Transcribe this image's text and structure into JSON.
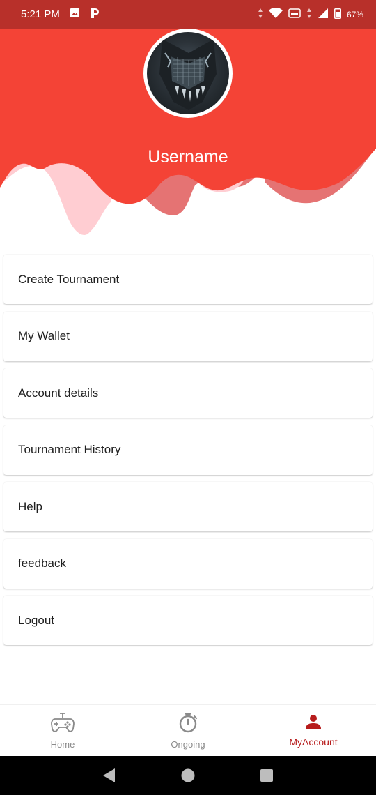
{
  "status_bar": {
    "time": "5:21 PM",
    "battery": "67%",
    "icons": [
      "image-icon",
      "p-app-icon",
      "data-arrows-icon",
      "wifi-icon",
      "volte-icon",
      "signal-icon",
      "battery-icon"
    ]
  },
  "profile": {
    "username": "Username",
    "avatar": "masked-face-avatar"
  },
  "menu": {
    "items": [
      {
        "label": "Create Tournament"
      },
      {
        "label": "My Wallet"
      },
      {
        "label": "Account details"
      },
      {
        "label": "Tournament History"
      },
      {
        "label": "Help"
      },
      {
        "label": "feedback"
      },
      {
        "label": "Logout"
      }
    ]
  },
  "bottom_nav": {
    "tabs": [
      {
        "label": "Home",
        "icon": "gamepad-icon"
      },
      {
        "label": "Ongoing",
        "icon": "stopwatch-icon"
      },
      {
        "label": "MyAccount",
        "icon": "person-icon",
        "active": true
      }
    ]
  },
  "system_nav": {
    "buttons": [
      "back-icon",
      "home-circle-icon",
      "recents-square-icon"
    ]
  },
  "colors": {
    "status_bar": "#b8302a",
    "header_red": "#f44336",
    "wave_mid": "#e57373",
    "wave_light": "#ffcdd2",
    "accent": "#b71c1c"
  }
}
